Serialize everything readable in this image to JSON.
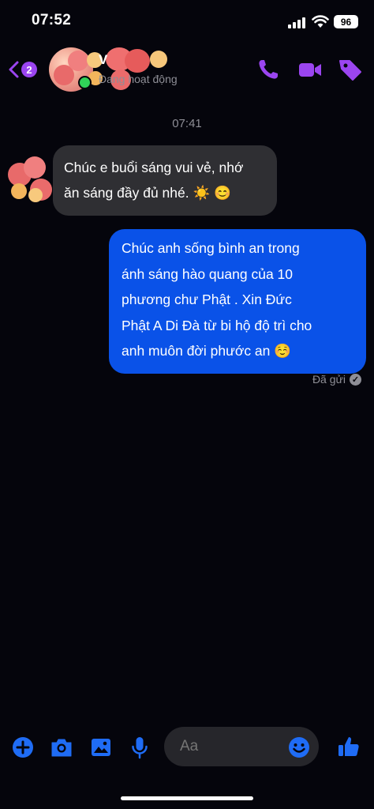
{
  "status_bar": {
    "time": "07:52",
    "battery": "96"
  },
  "header": {
    "back_badge_count": "2",
    "contact_name": "V",
    "contact_status": "Đang hoạt động",
    "icons": [
      "back-chevron-icon",
      "phone-icon",
      "video-camera-icon",
      "tag-icon"
    ],
    "accent_color": "#9b45f0"
  },
  "chat": {
    "timestamp": "07:41",
    "incoming": {
      "line1": "Chúc e buổi sáng vui vẻ, nhớ",
      "line2": "ăn sáng đầy đủ nhé. ☀️ 😊"
    },
    "outgoing": {
      "line1": "Chúc anh sống bình an trong",
      "line2": "ánh sáng hào quang của 10",
      "line3": "phương chư Phật . Xin Đức",
      "line4": "Phật A Di Đà từ bi hộ độ trì cho",
      "line5": "anh muôn đời phước an ☺️"
    },
    "delivery_status": "Đã gửi",
    "outgoing_color": "#0a52e8",
    "incoming_color": "#2f2f33"
  },
  "composer": {
    "placeholder": "Aa",
    "icons": [
      "plus-icon",
      "camera-icon",
      "image-icon",
      "microphone-icon",
      "emoji-icon",
      "thumbs-up-icon"
    ],
    "accent_color": "#1f6cf5"
  }
}
